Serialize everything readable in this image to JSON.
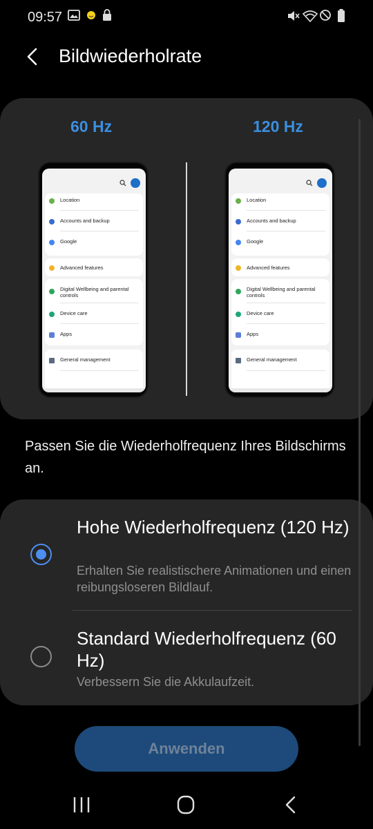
{
  "status_bar": {
    "time": "09:57",
    "icons": [
      "gallery-icon",
      "emoji-icon",
      "lock-icon",
      "mute-icon",
      "wifi-icon",
      "do-not-disturb-icon",
      "battery-icon"
    ]
  },
  "header": {
    "title": "Bildwiederholrate",
    "back_icon": "back-arrow-icon"
  },
  "preview": {
    "left_label": "60 Hz",
    "right_label": "120 Hz",
    "phone_items": {
      "location": "Location",
      "accounts": "Accounts and backup",
      "google": "Google",
      "advanced": "Advanced features",
      "wellbeing": "Digital Wellbeing and parental controls",
      "device_care": "Device care",
      "apps": "Apps",
      "general": "General management"
    }
  },
  "description": "Passen Sie die Wiederholfrequenz Ihres Bildschirms an.",
  "options": {
    "high": {
      "title": "Hohe Wiederholfrequenz (120 Hz)",
      "subtitle": "Erhalten Sie realistischere Animationen und einen reibungsloseren Bildlauf.",
      "selected": true
    },
    "standard": {
      "title": "Standard Wiederholfrequenz (60 Hz)",
      "subtitle": "Verbessern Sie die Akkulaufzeit.",
      "selected": false
    }
  },
  "apply_button": "Anwenden",
  "colors": {
    "accent": "#3b8fe0",
    "radio_selected": "#4d8ef0",
    "card_bg": "#262626",
    "button_bg": "#1d4a7a"
  },
  "nav_bar": {
    "icons": [
      "recents-icon",
      "home-icon",
      "back-icon"
    ]
  }
}
